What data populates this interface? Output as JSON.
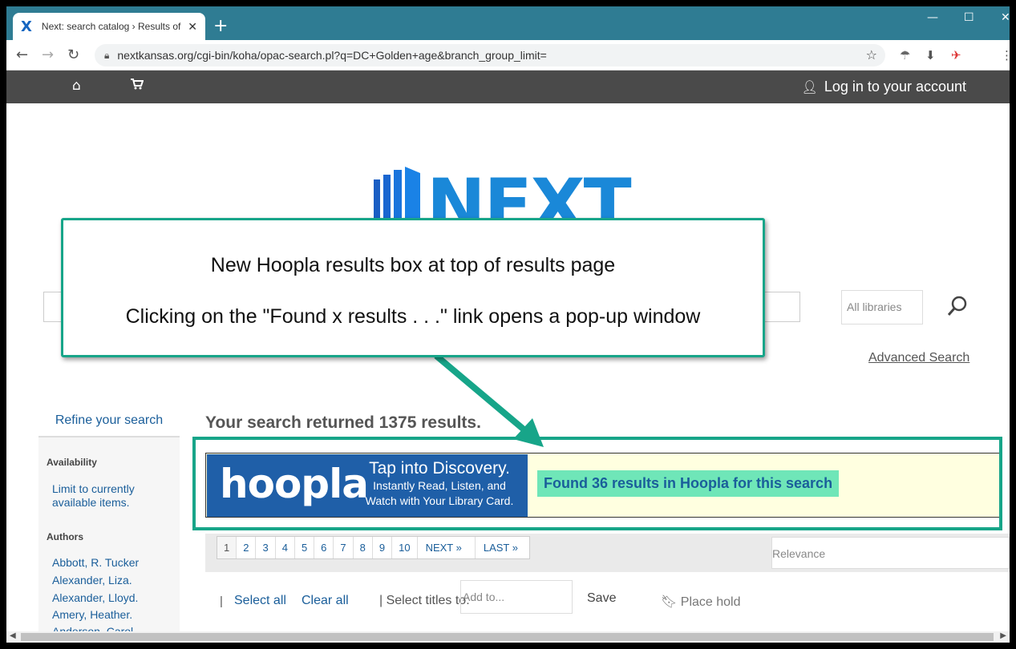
{
  "browser": {
    "tab_title": "Next: search catalog › Results of s",
    "url": "nextkansas.org/cgi-bin/koha/opac-search.pl?q=DC+Golden+age&branch_group_limit="
  },
  "sitenav": {
    "login": "Log in to your account"
  },
  "logo": {
    "text": "NEXT"
  },
  "search": {
    "branch_placeholder": "All libraries",
    "advanced_link": "Advanced Search"
  },
  "callout": {
    "line1": "New Hoopla results box at top of results page",
    "line2": "Clicking on the \"Found x results . . .\" link opens a pop-up window"
  },
  "sidebar": {
    "refine": "Refine your search",
    "availability_heading": "Availability",
    "availability_link": "Limit to currently available items.",
    "authors_heading": "Authors",
    "authors": [
      "Abbott, R. Tucker",
      "Alexander, Liza.",
      "Alexander, Lloyd.",
      "Amery, Heather.",
      "Anderson, Carol."
    ]
  },
  "results": {
    "count_text": "Your search returned 1375 results."
  },
  "hoopla": {
    "logo": "hoopla",
    "tag1": "Tap into Discovery.",
    "tag2": "Instantly Read, Listen, and",
    "tag3": "Watch with Your Library Card.",
    "link": "Found 36 results in Hoopla for this search"
  },
  "pager": {
    "pages": [
      "1",
      "2",
      "3",
      "4",
      "5",
      "6",
      "7",
      "8",
      "9",
      "10"
    ],
    "next": "NEXT »",
    "last": "LAST »",
    "sort": "Relevance"
  },
  "actions": {
    "select_all": "Select all",
    "clear_all": "Clear all",
    "select_titles": "| Select titles to:",
    "add_to_placeholder": "Add to...",
    "save": "Save",
    "place_hold": "Place hold"
  },
  "colors": {
    "accent_teal": "#17a589",
    "nav_dark": "#4a4a4a",
    "chrome_teal": "#2f7c93",
    "link_blue": "#1a5e9a",
    "hoopla_blue": "#1f5fa8"
  }
}
